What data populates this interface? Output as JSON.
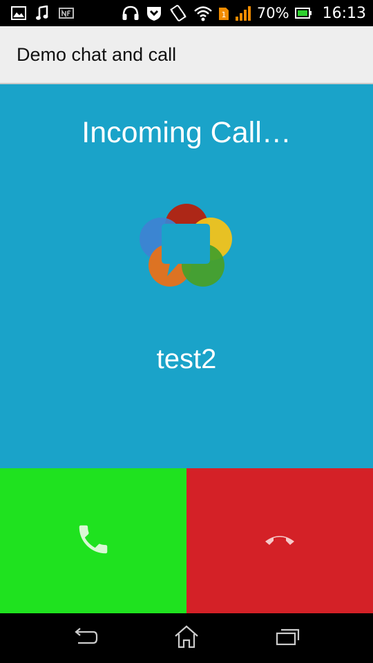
{
  "status_bar": {
    "battery_text": "70%",
    "time": "16:13",
    "icons": [
      "image-icon",
      "music-note-icon",
      "nfc-icon",
      "headset-icon",
      "shield-icon",
      "vibrate-icon",
      "wifi-icon",
      "sim-icon",
      "signal-icon",
      "battery-icon"
    ]
  },
  "app": {
    "title": "Demo chat and call"
  },
  "call": {
    "heading": "Incoming Call…",
    "caller_name": "test2",
    "accept_icon": "phone-icon",
    "reject_icon": "hang-up-icon"
  },
  "colors": {
    "background": "#1aa3c9",
    "accept": "#1fe21f",
    "reject": "#d42127"
  },
  "nav": {
    "icons": [
      "back-icon",
      "home-icon",
      "recents-icon"
    ]
  }
}
